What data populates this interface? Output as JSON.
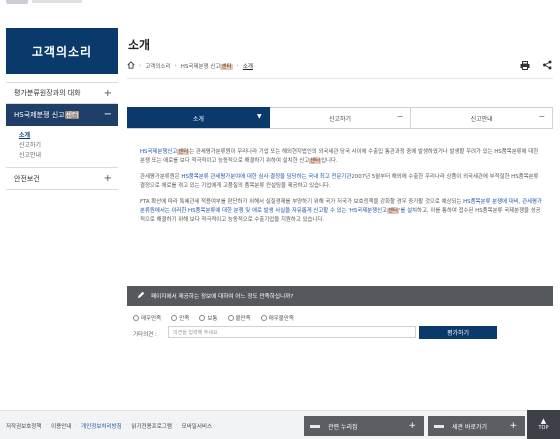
{
  "sidebar": {
    "title": "고객의소리",
    "items": [
      {
        "label": "평가분류원장과의 대화",
        "sign": "+"
      },
      {
        "label_prefix": "HS국제분쟁 신고",
        "label_hl": "센터",
        "sign": "−"
      },
      {
        "label": "안전보건",
        "sign": "+"
      }
    ],
    "subitems": [
      "소개",
      "신고하기",
      "신고안내"
    ]
  },
  "page": {
    "title": "소개",
    "breadcrumb": [
      "고객의소리",
      "HS국제분쟁 신고",
      "센터",
      "소개"
    ]
  },
  "tabs": [
    {
      "label": "소개",
      "icon": "chevron-down-icon"
    },
    {
      "label": "신고하기",
      "icon": "minus-icon"
    },
    {
      "label": "신고안내",
      "icon": "minus-icon"
    }
  ],
  "content": {
    "p1": {
      "a_blue": "HS국제분쟁신고",
      "a_hl": "센터",
      "b": "는 관세평가분류원이 우리나라 기업 또는 해외현지법인의 외국세관 당국 사이에 수출입 통관과정 중에 발생하였거나 발생할 우려가 있는 HS품목분류에 대한 분쟁 또는 애로를 보다 적극적이고 능동적으로 해결하기 위하여 설치한 신고",
      "c_hl": "센터",
      "d": "입니다."
    },
    "p2": {
      "a": "관세평가분류원은 ",
      "b_blue": "HS품목분류 관세평가분야에 대한 심사·결정을 담당하는 국내 최고 전문기관",
      "c": "2007년 5월부터 해외에 수출한 우리나라 상품이 외국세관에 부적절한 HS품목분류 결정으로 애로를 겪고 있는 기업에게 고품질의 품목분류 컨설팅을 제공하고 있습니다."
    },
    "p3": {
      "a": "FTA 확산에 따라 특혜관세 적용여부를 판단하기 위해서 실질경제를 부양하기 위해 국가 저국가 보호정책을 강화할 경우 증가할 것으로 예상되는 ",
      "b_blue": "HS품목분류 분쟁에 대비, 관세평가분류원에서는 이러한 HS품목분류에 대한 분쟁 및 애로 발생 사실을 자유롭게 신고할 수 있는 'HS국제분쟁신고",
      "c_hl": "센터",
      "d_blue": "'를 설치",
      "e": "하고, 이를 통하여 접수된 HS품목분류 국제분쟁을 성공적으로 해결하기 위해 보다 적극적이고 능동적으로 수출기업을 지원하고 있습니다."
    }
  },
  "survey": {
    "question": "페이지에서 제공하는 정보에 대하여 어느 정도 만족하십니까?",
    "options": [
      "매우만족",
      "만족",
      "보통",
      "불만족",
      "매우불만족"
    ],
    "opinion_label": "기타의견 :",
    "opinion_placeholder": "의견을 입력해 주세요",
    "submit_label": "평가하기"
  },
  "footer": {
    "links": [
      "저작권보호정책",
      "이용안내",
      "개인정보처리방침",
      "읽기전용프로그램",
      "모바일서비스"
    ],
    "highlight_index": 2,
    "selects": [
      "관련 누리집",
      "세관 바로가기"
    ],
    "top_label": "TOP"
  }
}
